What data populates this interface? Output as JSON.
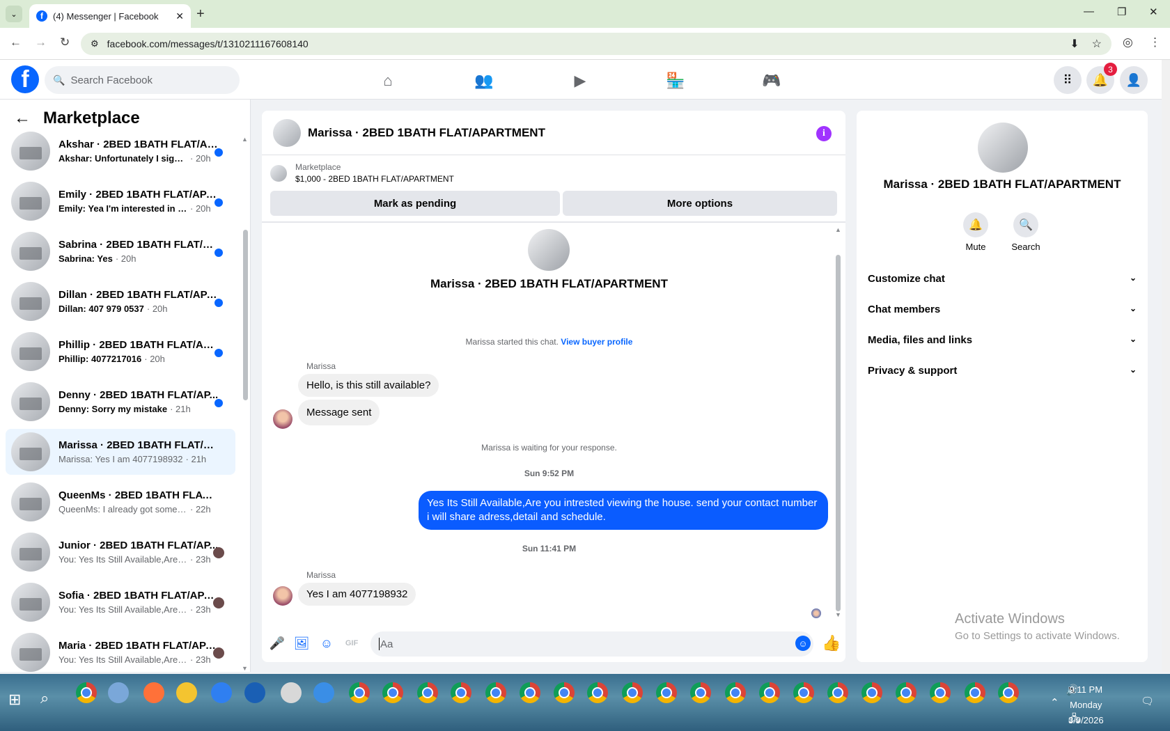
{
  "browser": {
    "tab_title": "(4) Messenger | Facebook",
    "url": "facebook.com/messages/t/1310211167608140"
  },
  "fb": {
    "search_placeholder": "Search Facebook",
    "notification_count": "3"
  },
  "sidebar": {
    "title": "Marketplace",
    "conversations": [
      {
        "name": "Akshar · 2BED 1BATH FLAT/AP...",
        "preview": "Akshar: Unfortunately I signed ...",
        "time": "20h",
        "unread": true
      },
      {
        "name": "Emily · 2BED 1BATH FLAT/APA...",
        "preview": "Emily: Yea I'm interested in see...",
        "time": "20h",
        "unread": true
      },
      {
        "name": "Sabrina · 2BED 1BATH FLAT/AP...",
        "preview": "Sabrina: Yes",
        "time": "20h",
        "unread": true
      },
      {
        "name": "Dillan · 2BED 1BATH FLAT/APA...",
        "preview": "Dillan: 407 979 0537",
        "time": "20h",
        "unread": true
      },
      {
        "name": "Phillip · 2BED 1BATH FLAT/APA...",
        "preview": "Phillip: 4077217016",
        "time": "20h",
        "unread": true
      },
      {
        "name": "Denny · 2BED 1BATH FLAT/AP...",
        "preview": "Denny: Sorry my mistake",
        "time": "21h",
        "unread": true
      },
      {
        "name": "Marissa · 2BED 1BATH FLAT/APA...",
        "preview": "Marissa: Yes I am 4077198932",
        "time": "21h",
        "unread": false,
        "active": true
      },
      {
        "name": "QueenMs · 2BED 1BATH FLAT/A...",
        "preview": "QueenMs: I already got somethin...",
        "time": "22h",
        "unread": false
      },
      {
        "name": "Junior · 2BED 1BATH FLAT/AP...",
        "preview": "You: Yes Its Still Available,Are y...",
        "time": "23h",
        "unread": false
      },
      {
        "name": "Sofia · 2BED 1BATH FLAT/APA...",
        "preview": "You: Yes Its Still Available,Are y...",
        "time": "23h",
        "unread": false
      },
      {
        "name": "Maria · 2BED 1BATH FLAT/APAR...",
        "preview": "You: Yes Its Still Available,Are you i...",
        "time": "23h",
        "unread": false
      }
    ]
  },
  "chat": {
    "title": "Marissa · 2BED 1BATH FLAT/APARTMENT",
    "marketplace_label": "Marketplace",
    "listing": "$1,000 - 2BED 1BATH FLAT/APARTMENT",
    "pending_button": "Mark as pending",
    "more_button": "More options",
    "started_note": "Marissa started this chat.",
    "buyer_profile_link": "View buyer profile",
    "sender_name": "Marissa",
    "msg1": "Hello, is this still available?",
    "msg2": "Message sent",
    "waiting_note": "Marissa is waiting for your response.",
    "time1": "Sun 9:52 PM",
    "outgoing": "Yes Its Still Available,Are you intrested viewing the house. send your contact number i will share adress,detail and schedule.",
    "time2": "Sun 11:41 PM",
    "msg3": "Yes I am 4077198932",
    "composer_placeholder": "Aa"
  },
  "right_panel": {
    "name": "Marissa · 2BED 1BATH FLAT/APARTMENT",
    "mute_label": "Mute",
    "search_label": "Search",
    "sections": [
      "Customize chat",
      "Chat members",
      "Media, files and links",
      "Privacy & support"
    ]
  },
  "watermark": {
    "line1": "Activate Windows",
    "line2": "Go to Settings to activate Windows."
  },
  "taskbar": {
    "time": "9:11 PM",
    "day": "Monday",
    "date": "3/9/2026"
  },
  "colors": {
    "fb_blue": "#0866ff",
    "unread_dot": "#0866ff",
    "badge": "#e41e3f",
    "info": "#a033ff"
  }
}
